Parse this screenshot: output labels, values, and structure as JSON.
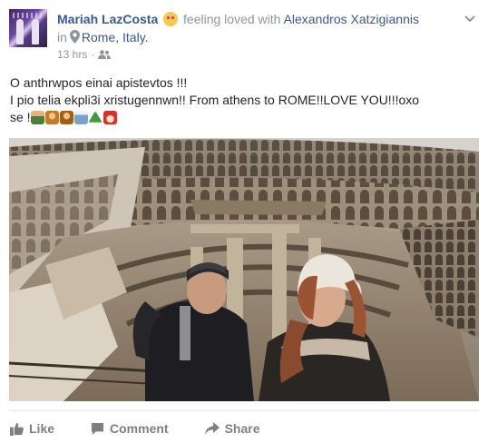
{
  "header": {
    "name": "Mariah LazCosta",
    "feeling_text": "feeling loved with",
    "tagged": "Alexandros Xatzigiannis",
    "in_word": "in",
    "location": "Rome, Italy.",
    "time": "13 hrs",
    "separator": "·"
  },
  "post": {
    "line1": "O anthrwpos einai apistevtos !!!",
    "line2": "I pio telia ekpli3i xristugennwn!! From athens to ROME!!LOVE YOU!!!oxo",
    "line3": "se !"
  },
  "actions": {
    "like": "Like",
    "comment": "Comment",
    "share": "Share"
  },
  "colors": {
    "link": "#365899",
    "meta": "#90949c",
    "action": "#7f7f7f"
  },
  "icons": [
    "feeling-emoji-icon",
    "location-pin-icon",
    "friends-audience-icon",
    "chevron-down-icon",
    "like-icon",
    "comment-icon",
    "share-icon"
  ]
}
